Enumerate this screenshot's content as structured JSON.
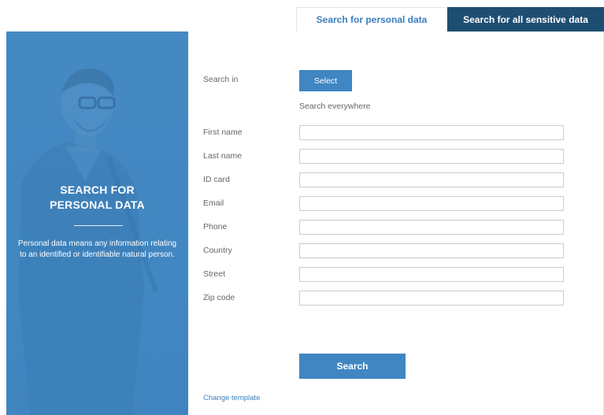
{
  "tabs": {
    "personal": "Search for personal data",
    "sensitive": "Search for all sensitive data"
  },
  "hero": {
    "title_line1": "SEARCH FOR",
    "title_line2": "PERSONAL DATA",
    "description_line1": "Personal data means any information relating",
    "description_line2": "to an identified or identifiable natural person."
  },
  "search_in": {
    "label": "Search in",
    "button": "Select",
    "scope": "Search everywhere"
  },
  "fields": {
    "first_name": {
      "label": "First name",
      "value": ""
    },
    "last_name": {
      "label": "Last name",
      "value": ""
    },
    "id_card": {
      "label": "ID card",
      "value": ""
    },
    "email": {
      "label": "Email",
      "value": ""
    },
    "phone": {
      "label": "Phone",
      "value": ""
    },
    "country": {
      "label": "Country",
      "value": ""
    },
    "street": {
      "label": "Street",
      "value": ""
    },
    "zip_code": {
      "label": "Zip code",
      "value": ""
    }
  },
  "actions": {
    "search": "Search",
    "change_template": "Change template"
  },
  "colors": {
    "accent": "#3f86c2",
    "dark_tab": "#1e4d72",
    "active_tab_text": "#3a7fbf"
  }
}
